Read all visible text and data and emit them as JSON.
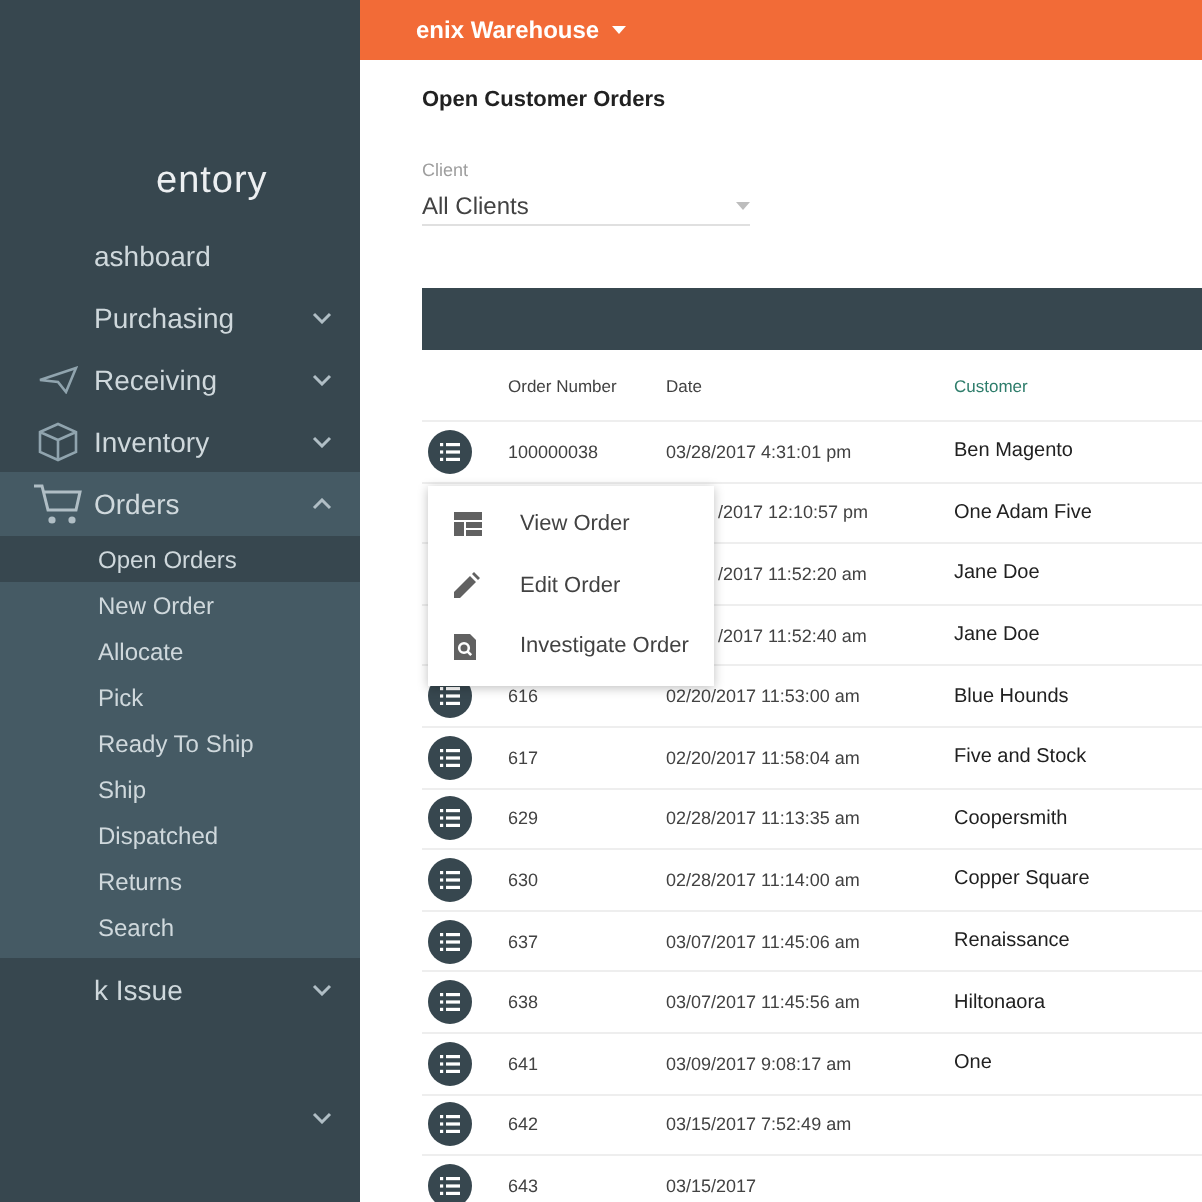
{
  "top_bar": {
    "warehouse": "enix Warehouse"
  },
  "sidebar": {
    "logo": "entory",
    "items": [
      {
        "label": "ashboard"
      },
      {
        "label": "Purchasing",
        "expanded": false
      },
      {
        "label": "Receiving",
        "expanded": false
      },
      {
        "label": "Inventory",
        "expanded": false
      },
      {
        "label": "Orders",
        "expanded": true,
        "children": [
          {
            "label": "Open Orders",
            "selected": true
          },
          {
            "label": "New Order",
            "selected": false
          },
          {
            "label": "Allocate",
            "selected": false
          },
          {
            "label": "Pick",
            "selected": false
          },
          {
            "label": "Ready To Ship",
            "selected": false
          },
          {
            "label": "Ship",
            "selected": false
          },
          {
            "label": "Dispatched",
            "selected": false
          },
          {
            "label": "Returns",
            "selected": false
          },
          {
            "label": "Search",
            "selected": false
          }
        ]
      },
      {
        "label": "k Issue",
        "expanded": false
      },
      {
        "expanded": false
      }
    ]
  },
  "page": {
    "title": "Open Customer Orders",
    "client_filter": {
      "label": "Client",
      "value": "All Clients"
    }
  },
  "table": {
    "columns": [
      {
        "label": "Order Number",
        "sorted": false
      },
      {
        "label": "Date",
        "sorted": false
      },
      {
        "label": "Customer",
        "sorted": true
      }
    ],
    "rows": [
      {
        "order_number": "100000038",
        "date": "03/28/2017 4:31:01 pm",
        "customer": "Ben Magento"
      },
      {
        "date": "/2017 12:10:57 pm",
        "customer": "One Adam Five"
      },
      {
        "date": "/2017 11:52:20 am",
        "customer": "Jane Doe"
      },
      {
        "date": "/2017 11:52:40 am",
        "customer": "Jane Doe"
      },
      {
        "order_number": "616",
        "date": "02/20/2017 11:53:00 am",
        "customer": "Blue Hounds"
      },
      {
        "order_number": "617",
        "date": "02/20/2017 11:58:04 am",
        "customer": "Five and Stock"
      },
      {
        "order_number": "629",
        "date": "02/28/2017 11:13:35 am",
        "customer": "Coopersmith"
      },
      {
        "order_number": "630",
        "date": "02/28/2017 11:14:00 am",
        "customer": "Copper Square"
      },
      {
        "order_number": "637",
        "date": "03/07/2017 11:45:06 am",
        "customer": "Renaissance"
      },
      {
        "order_number": "638",
        "date": "03/07/2017 11:45:56 am",
        "customer": "Hiltonaora"
      },
      {
        "order_number": "641",
        "date": "03/09/2017 9:08:17 am",
        "customer": "One"
      },
      {
        "order_number": "642",
        "date": "03/15/2017 7:52:49 am"
      },
      {
        "order_number": "643",
        "date": "03/15/2017"
      }
    ]
  },
  "context_menu": {
    "items": [
      {
        "label": "View Order"
      },
      {
        "label": "Edit Order"
      },
      {
        "label": "Investigate Order"
      }
    ]
  }
}
